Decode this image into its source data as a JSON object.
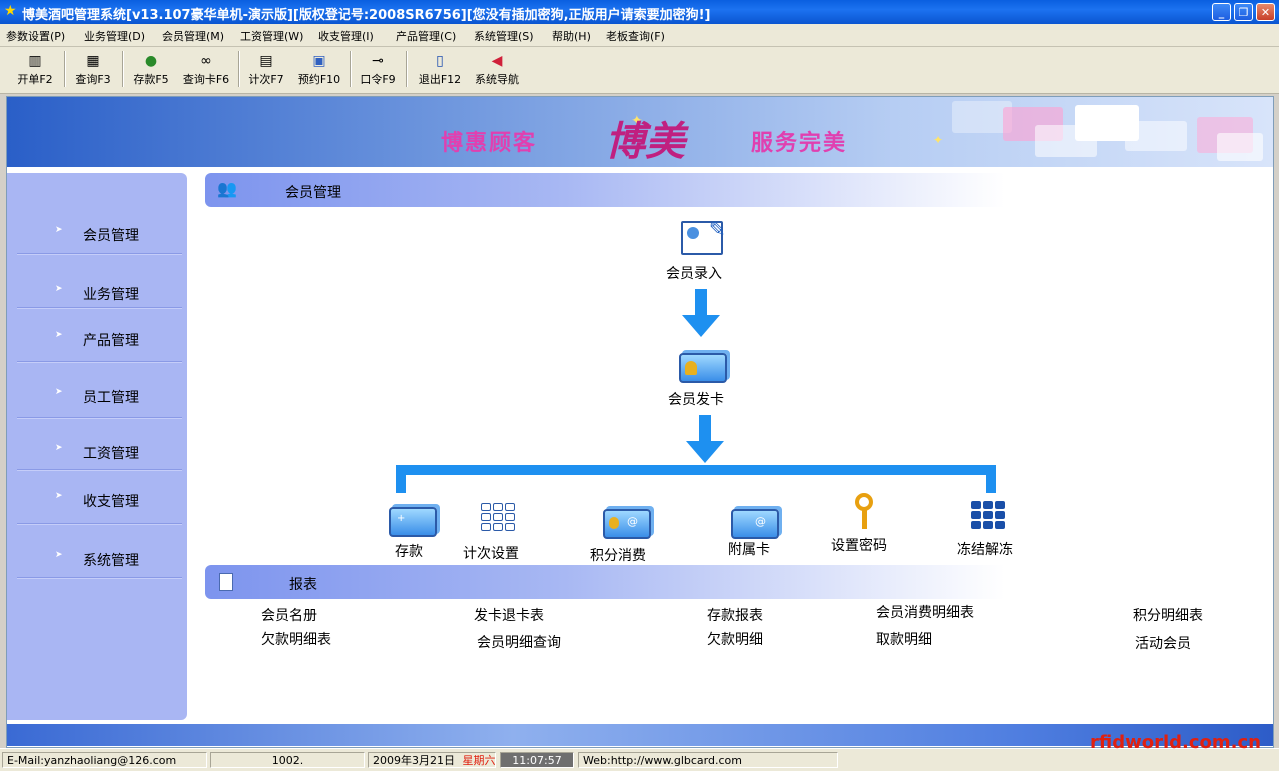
{
  "window": {
    "title": "博美酒吧管理系统[v13.107豪华单机-演示版][版权登记号:2008SR6756][您没有插加密狗,正版用户请索要加密狗!]",
    "minimize_glyph": "_",
    "maximize_glyph": "❐",
    "close_glyph": "✕"
  },
  "menubar": {
    "items": [
      {
        "label": "参数设置(P)"
      },
      {
        "label": "业务管理(D)"
      },
      {
        "label": "会员管理(M)"
      },
      {
        "label": "工资管理(W)"
      },
      {
        "label": "收支管理(I)"
      },
      {
        "label": "产品管理(C)"
      },
      {
        "label": "系统管理(S)"
      },
      {
        "label": "帮助(H)"
      },
      {
        "label": "老板查询(F)"
      }
    ]
  },
  "toolbar": {
    "items": [
      {
        "label": "开单F2",
        "icon": "open-order-icon"
      },
      {
        "label": "查询F3",
        "icon": "query-icon"
      },
      {
        "label": "存款F5",
        "icon": "money-bag-icon"
      },
      {
        "label": "查询卡F6",
        "icon": "binoculars-icon"
      },
      {
        "label": "计次F7",
        "icon": "counter-icon"
      },
      {
        "label": "预约F10",
        "icon": "reservation-icon"
      },
      {
        "label": "口令F9",
        "icon": "key-icon"
      },
      {
        "label": "退出F12",
        "icon": "exit-icon"
      },
      {
        "label": "系统导航",
        "icon": "back-arrow-icon"
      }
    ]
  },
  "banner": {
    "slogan_left": "博惠顾客",
    "logo_text": "博美",
    "slogan_right": "服务完美"
  },
  "sidebar": {
    "items": [
      {
        "label": "会员管理"
      },
      {
        "label": "业务管理"
      },
      {
        "label": "产品管理"
      },
      {
        "label": "员工管理"
      },
      {
        "label": "工资管理"
      },
      {
        "label": "收支管理"
      },
      {
        "label": "系统管理"
      }
    ]
  },
  "member_section": {
    "title": "会员管理",
    "steps": {
      "entry": "会员录入",
      "issue_card": "会员发卡"
    },
    "actions": [
      {
        "label": "存款",
        "icon": "card-stack-icon"
      },
      {
        "label": "计次设置",
        "icon": "grid-icon"
      },
      {
        "label": "积分消费",
        "icon": "points-card-icon"
      },
      {
        "label": "附属卡",
        "icon": "sub-card-icon"
      },
      {
        "label": "设置密码",
        "icon": "key-icon"
      },
      {
        "label": "冻结解冻",
        "icon": "freeze-grid-icon"
      }
    ]
  },
  "report_section": {
    "title": "报表",
    "links": [
      {
        "label": "会员名册"
      },
      {
        "label": "发卡退卡表"
      },
      {
        "label": "存款报表"
      },
      {
        "label": "会员消费明细表"
      },
      {
        "label": "积分明细表"
      },
      {
        "label": "欠款明细表"
      },
      {
        "label": "会员明细查询"
      },
      {
        "label": "欠款明细"
      },
      {
        "label": "取款明细"
      },
      {
        "label": "活动会员"
      }
    ]
  },
  "statusbar": {
    "email": "E-Mail:yanzhaoliang@126.com",
    "user_code": "1002.",
    "date": "2009年3月21日",
    "weekday": "星期六",
    "time": "11:07:57",
    "web": "Web:http://www.glbcard.com"
  },
  "watermark": "rfidworld.com.cn",
  "colors": {
    "accent_blue": "#1e90f0",
    "sidebar_bg": "#a9b6f3",
    "weekday_red": "#e02010",
    "slogan_pink": "#e040b0"
  }
}
